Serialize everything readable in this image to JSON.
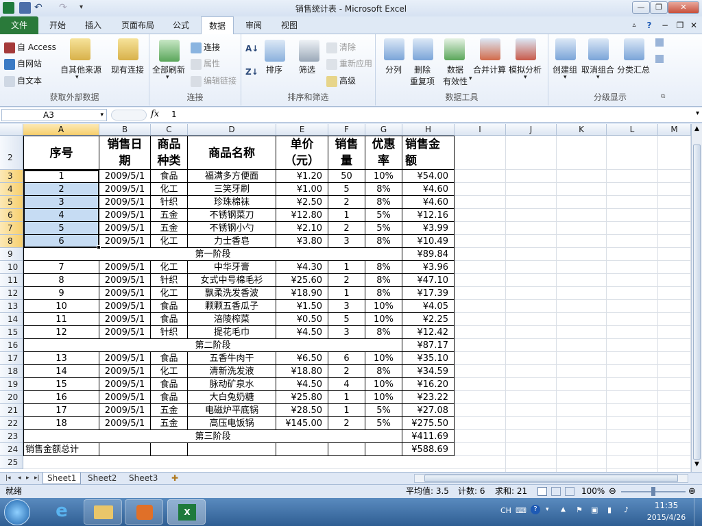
{
  "window": {
    "title": "销售统计表 - Microsoft Excel"
  },
  "tabs": [
    "文件",
    "开始",
    "插入",
    "页面布局",
    "公式",
    "数据",
    "审阅",
    "视图"
  ],
  "ribbon": {
    "g1": {
      "label": "获取外部数据",
      "access": "自 Access",
      "web": "自网站",
      "text": "自文本",
      "other": "自其他来源",
      "existing": "现有连接"
    },
    "g2": {
      "label": "连接",
      "refresh": "全部刷新",
      "connections": "连接",
      "properties": "属性",
      "editlinks": "编辑链接"
    },
    "g3": {
      "label": "排序和筛选",
      "sort": "排序",
      "filter": "筛选",
      "clear": "清除",
      "reapply": "重新应用",
      "advanced": "高级"
    },
    "g4": {
      "label": "数据工具",
      "split": "分列",
      "remove1": "删除",
      "remove2": "重复项",
      "valid1": "数据",
      "valid2": "有效性",
      "consolidate": "合并计算",
      "whatif": "模拟分析"
    },
    "g5": {
      "label": "分级显示",
      "group": "创建组",
      "ungroup": "取消组合",
      "subtotal": "分类汇总"
    }
  },
  "formula": {
    "namebox": "A3",
    "fx": "fx",
    "value": "1"
  },
  "columns": [
    "A",
    "B",
    "C",
    "D",
    "E",
    "F",
    "G",
    "H",
    "I",
    "J",
    "K",
    "L",
    "M"
  ],
  "headers": {
    "a": "序号",
    "b1": "销售日",
    "b2": "期",
    "c1": "商品",
    "c2": "种类",
    "d": "商品名称",
    "e1": "单价",
    "e2": "（元）",
    "f1": "销售",
    "f2": "量",
    "g1": "优惠",
    "g2": "率",
    "h1": "销售金",
    "h2": "额"
  },
  "rows": [
    {
      "n": "3",
      "type": "data",
      "cells": [
        "1",
        "2009/5/1",
        "食品",
        "福满多方便面",
        "¥1.20",
        "50",
        "10%",
        "¥54.00"
      ]
    },
    {
      "n": "4",
      "type": "data",
      "cells": [
        "2",
        "2009/5/1",
        "化工",
        "三笑牙刷",
        "¥1.00",
        "5",
        "8%",
        "¥4.60"
      ]
    },
    {
      "n": "5",
      "type": "data",
      "cells": [
        "3",
        "2009/5/1",
        "针织",
        "珍珠棉袜",
        "¥2.50",
        "2",
        "8%",
        "¥4.60"
      ]
    },
    {
      "n": "6",
      "type": "data",
      "cells": [
        "4",
        "2009/5/1",
        "五金",
        "不锈钢菜刀",
        "¥12.80",
        "1",
        "5%",
        "¥12.16"
      ]
    },
    {
      "n": "7",
      "type": "data",
      "cells": [
        "5",
        "2009/5/1",
        "五金",
        "不锈钢小勺",
        "¥2.10",
        "2",
        "5%",
        "¥3.99"
      ]
    },
    {
      "n": "8",
      "type": "data",
      "cells": [
        "6",
        "2009/5/1",
        "化工",
        "力士香皂",
        "¥3.80",
        "3",
        "8%",
        "¥10.49"
      ]
    },
    {
      "n": "9",
      "type": "stage",
      "label": "第一阶段",
      "total": "¥89.84"
    },
    {
      "n": "10",
      "type": "data",
      "cells": [
        "7",
        "2009/5/1",
        "化工",
        "中华牙膏",
        "¥4.30",
        "1",
        "8%",
        "¥3.96"
      ]
    },
    {
      "n": "11",
      "type": "data",
      "cells": [
        "8",
        "2009/5/1",
        "针织",
        "女式中号棉毛衫",
        "¥25.60",
        "2",
        "8%",
        "¥47.10"
      ]
    },
    {
      "n": "12",
      "type": "data",
      "cells": [
        "9",
        "2009/5/1",
        "化工",
        "飘柔洗发香波",
        "¥18.90",
        "1",
        "8%",
        "¥17.39"
      ]
    },
    {
      "n": "13",
      "type": "data",
      "cells": [
        "10",
        "2009/5/1",
        "食品",
        "颗颗五香瓜子",
        "¥1.50",
        "3",
        "10%",
        "¥4.05"
      ]
    },
    {
      "n": "14",
      "type": "data",
      "cells": [
        "11",
        "2009/5/1",
        "食品",
        "涪陵榨菜",
        "¥0.50",
        "5",
        "10%",
        "¥2.25"
      ]
    },
    {
      "n": "15",
      "type": "data",
      "cells": [
        "12",
        "2009/5/1",
        "针织",
        "提花毛巾",
        "¥4.50",
        "3",
        "8%",
        "¥12.42"
      ]
    },
    {
      "n": "16",
      "type": "stage",
      "label": "第二阶段",
      "total": "¥87.17"
    },
    {
      "n": "17",
      "type": "data",
      "cells": [
        "13",
        "2009/5/1",
        "食品",
        "五香牛肉干",
        "¥6.50",
        "6",
        "10%",
        "¥35.10"
      ]
    },
    {
      "n": "18",
      "type": "data",
      "cells": [
        "14",
        "2009/5/1",
        "化工",
        "清新洗发液",
        "¥18.80",
        "2",
        "8%",
        "¥34.59"
      ]
    },
    {
      "n": "19",
      "type": "data",
      "cells": [
        "15",
        "2009/5/1",
        "食品",
        "脉动矿泉水",
        "¥4.50",
        "4",
        "10%",
        "¥16.20"
      ]
    },
    {
      "n": "20",
      "type": "data",
      "cells": [
        "16",
        "2009/5/1",
        "食品",
        "大白兔奶糖",
        "¥25.80",
        "1",
        "10%",
        "¥23.22"
      ]
    },
    {
      "n": "21",
      "type": "data",
      "cells": [
        "17",
        "2009/5/1",
        "五金",
        "电磁炉平底锅",
        "¥28.50",
        "1",
        "5%",
        "¥27.08"
      ]
    },
    {
      "n": "22",
      "type": "data",
      "cells": [
        "18",
        "2009/5/1",
        "五金",
        "高压电饭锅",
        "¥145.00",
        "2",
        "5%",
        "¥275.50"
      ]
    },
    {
      "n": "23",
      "type": "stage",
      "label": "第三阶段",
      "total": "¥411.69"
    },
    {
      "n": "24",
      "type": "grand",
      "label": "销售金额总计",
      "total": "¥588.69"
    },
    {
      "n": "25",
      "type": "empty"
    }
  ],
  "sheets": [
    "Sheet1",
    "Sheet2",
    "Sheet3"
  ],
  "status": {
    "ready": "就绪",
    "average": "平均值: 3.5",
    "count": "计数: 6",
    "sum": "求和: 21",
    "zoom": "100%"
  },
  "taskbar": {
    "lang": "CH",
    "time": "11:35",
    "date": "2015/4/26"
  },
  "colors": {
    "excel_green": "#2a7a3a",
    "selection": "#c6dcf3",
    "header_highlight": "#f7cf6d"
  }
}
